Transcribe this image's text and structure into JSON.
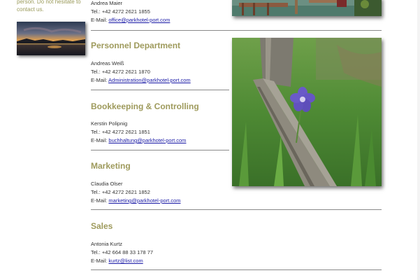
{
  "sidebar": {
    "intro_line1": "person. Do not hesitate to",
    "intro_line2": "contact us."
  },
  "reception": {
    "name": "Andrea Maier",
    "tel": "Tel.: +42 4272 2621 1855",
    "email_label": "E-Mail:",
    "email": "office@parkhotel-port.com"
  },
  "sections": [
    {
      "title": "Personnel Department",
      "name": "Andreas Weiß",
      "tel": "Tel.: +42 4272 2621 1870",
      "email_label": "E-Mail:",
      "email": "Administration@parkhotel-port.com"
    },
    {
      "title": "Bookkeeping & Controlling",
      "name": "Kerstin Polipnig",
      "tel": "Tel.: +42 4272 2621 1851",
      "email_label": "E-Mail:",
      "email": "buchhaltung@parkhotel-port.com"
    },
    {
      "title": "Marketing",
      "name": "Claudia Olser",
      "tel": "Tel.: +42 4272 2621 1852",
      "email_label": "E-Mail:",
      "email": "marketing@parkhotel-port.com"
    },
    {
      "title": "Sales",
      "name": "Antonia Kurtz",
      "tel": "Tel.: +42 664 88 33 178 77",
      "email_label": "E-Mail:",
      "email": "kurtz@list.com"
    }
  ],
  "colors": {
    "heading": "#9e9a5c",
    "link": "#1a1aa6",
    "sidebar_text": "#9a9a5a",
    "rule": "#8a8a8a"
  }
}
